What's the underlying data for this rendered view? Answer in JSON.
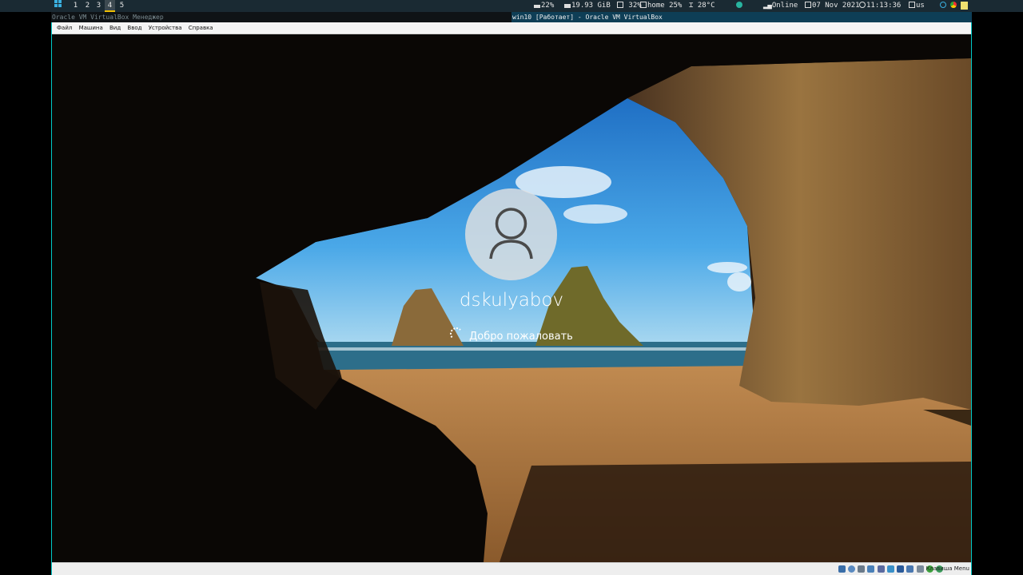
{
  "topbar": {
    "workspaces": [
      "1",
      "2",
      "3",
      "4",
      "5"
    ],
    "active_workspace": "4",
    "cpu": "22%",
    "memory": "19.93 GiB",
    "disk_root": "32%",
    "disk_home": "home 25%",
    "temperature": "28°C",
    "network": "Online",
    "date": "07 Nov 2021",
    "time": "11:13:36",
    "keyboard": "us"
  },
  "window": {
    "manager_title": "Oracle VM VirtualBox Менеджер",
    "vm_title": "win10 [Работает] - Oracle VM VirtualBox"
  },
  "menu": [
    "Файл",
    "Машина",
    "Вид",
    "Ввод",
    "Устройства",
    "Справка"
  ],
  "lockscreen": {
    "username": "dskulyabov",
    "status": "Добро пожаловать"
  },
  "statusbar": {
    "host_key": "Клавиша Menu"
  },
  "colors": {
    "frame_accent": "#00c8c8",
    "active_title_bg": "#0e3e56",
    "workspace_highlight": "#f0c000"
  }
}
